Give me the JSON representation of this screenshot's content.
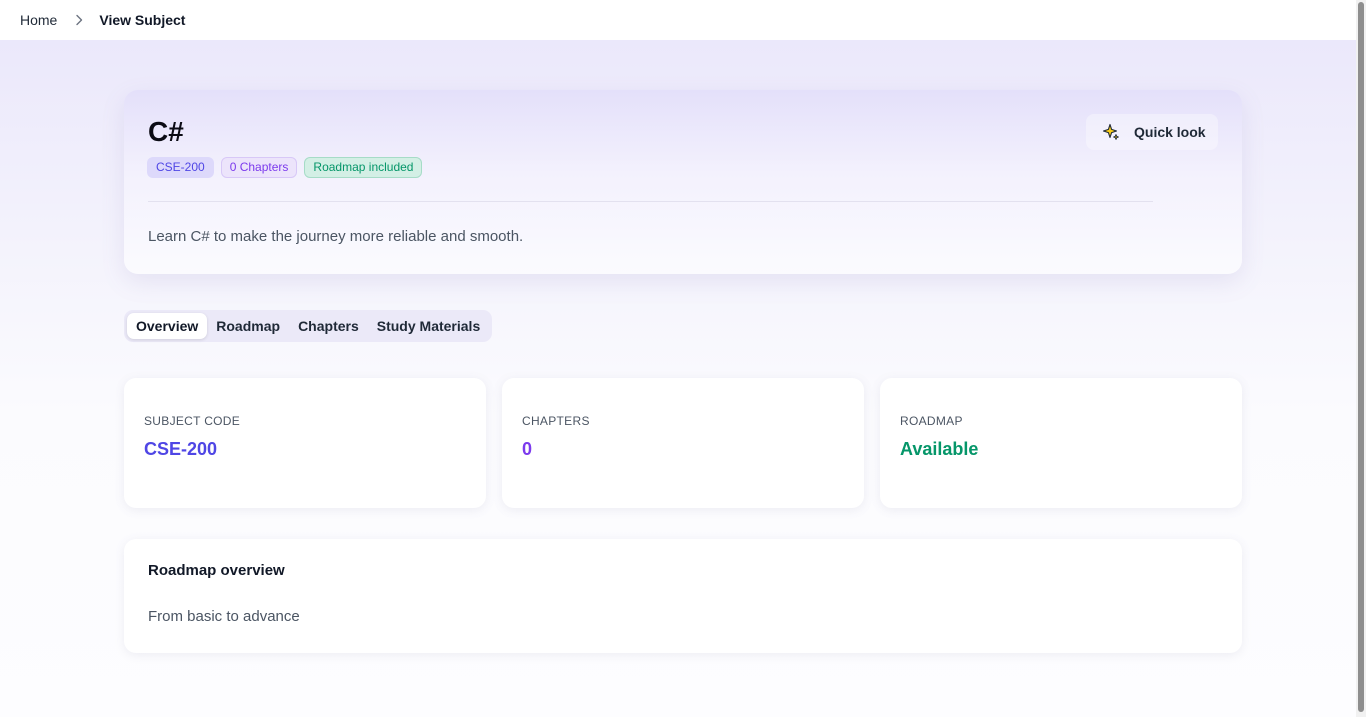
{
  "breadcrumb": {
    "home": "Home",
    "current": "View Subject"
  },
  "subject": {
    "title": "C#",
    "badges": {
      "code": "CSE-200",
      "chapters": "0 Chapters",
      "roadmap": "Roadmap included"
    },
    "description": "Learn C# to make the journey more reliable and smooth.",
    "quick_look_label": "Quick look"
  },
  "tabs": [
    {
      "label": "Overview",
      "active": true
    },
    {
      "label": "Roadmap",
      "active": false
    },
    {
      "label": "Chapters",
      "active": false
    },
    {
      "label": "Study Materials",
      "active": false
    }
  ],
  "stats": [
    {
      "label": "SUBJECT CODE",
      "value": "CSE-200",
      "color": "#4f46e5"
    },
    {
      "label": "CHAPTERS",
      "value": "0",
      "color": "#7c3aed"
    },
    {
      "label": "ROADMAP",
      "value": "Available",
      "color": "#059669"
    }
  ],
  "roadmap_overview": {
    "title": "Roadmap overview",
    "text": "From basic to advance"
  },
  "icons": {
    "breadcrumb_separator": "chevron-right-icon",
    "quick_look": "sparkle-icon"
  }
}
